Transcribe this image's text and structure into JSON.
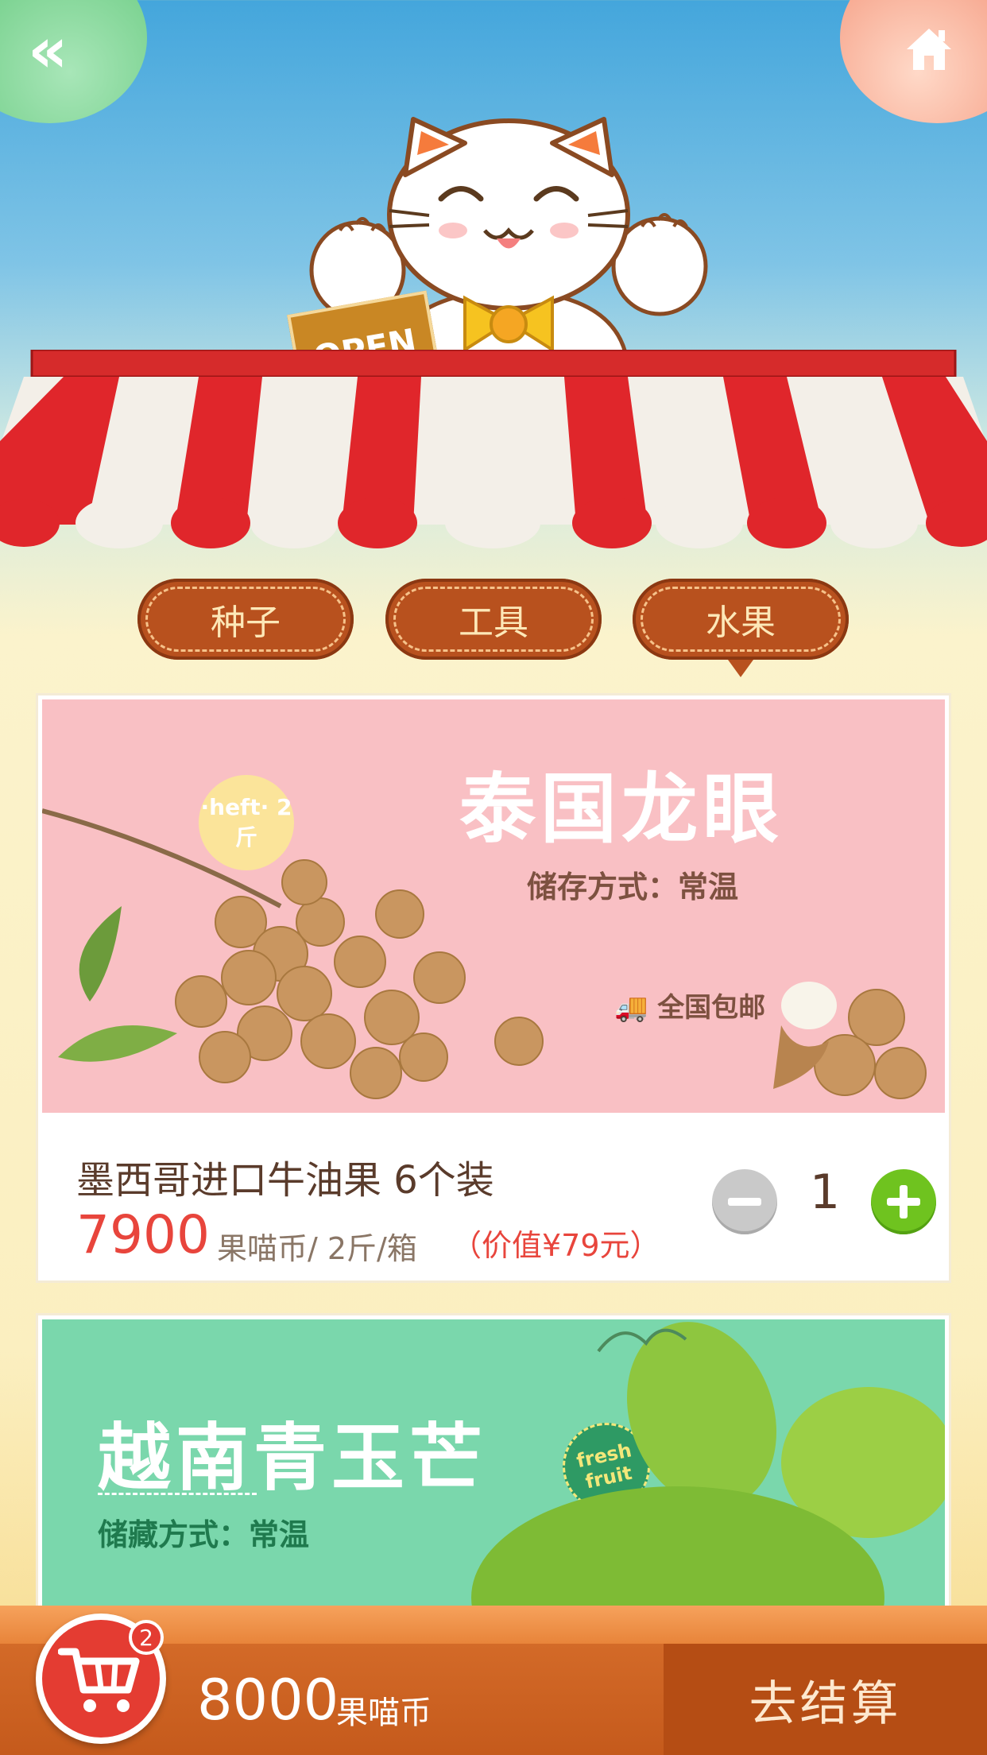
{
  "nav": {
    "back_icon": "double-chevron-left-icon",
    "home_icon": "home-icon"
  },
  "header": {
    "open_sign": "OPEN"
  },
  "tabs": [
    {
      "label": "种子",
      "active": false
    },
    {
      "label": "工具",
      "active": false
    },
    {
      "label": "水果",
      "active": true
    }
  ],
  "products": [
    {
      "banner_title": "泰国龙眼",
      "banner_storage": "储存方式：常温",
      "banner_shipping": "全国包邮",
      "banner_badge": "·heft· 2斤",
      "name": "墨西哥进口牛油果 6个装",
      "price": "7900",
      "unit": "果喵币/ 2斤/箱",
      "value": "（价值¥79元）",
      "quantity": "1",
      "banner_color": "#f9c0c4"
    },
    {
      "banner_title": "越南青玉芒",
      "banner_storage": "储藏方式：常温",
      "banner_badge": "fresh fruit",
      "banner_color": "#7ad7ac"
    }
  ],
  "cart": {
    "badge_count": "2",
    "total": "8000",
    "total_unit": "果喵币",
    "checkout_label": "去结算",
    "cart_icon": "shopping-cart-icon"
  },
  "colors": {
    "accent": "#e43c32",
    "tab_bg": "#b8511e",
    "plus": "#6fc31f",
    "price": "#e8453c"
  }
}
